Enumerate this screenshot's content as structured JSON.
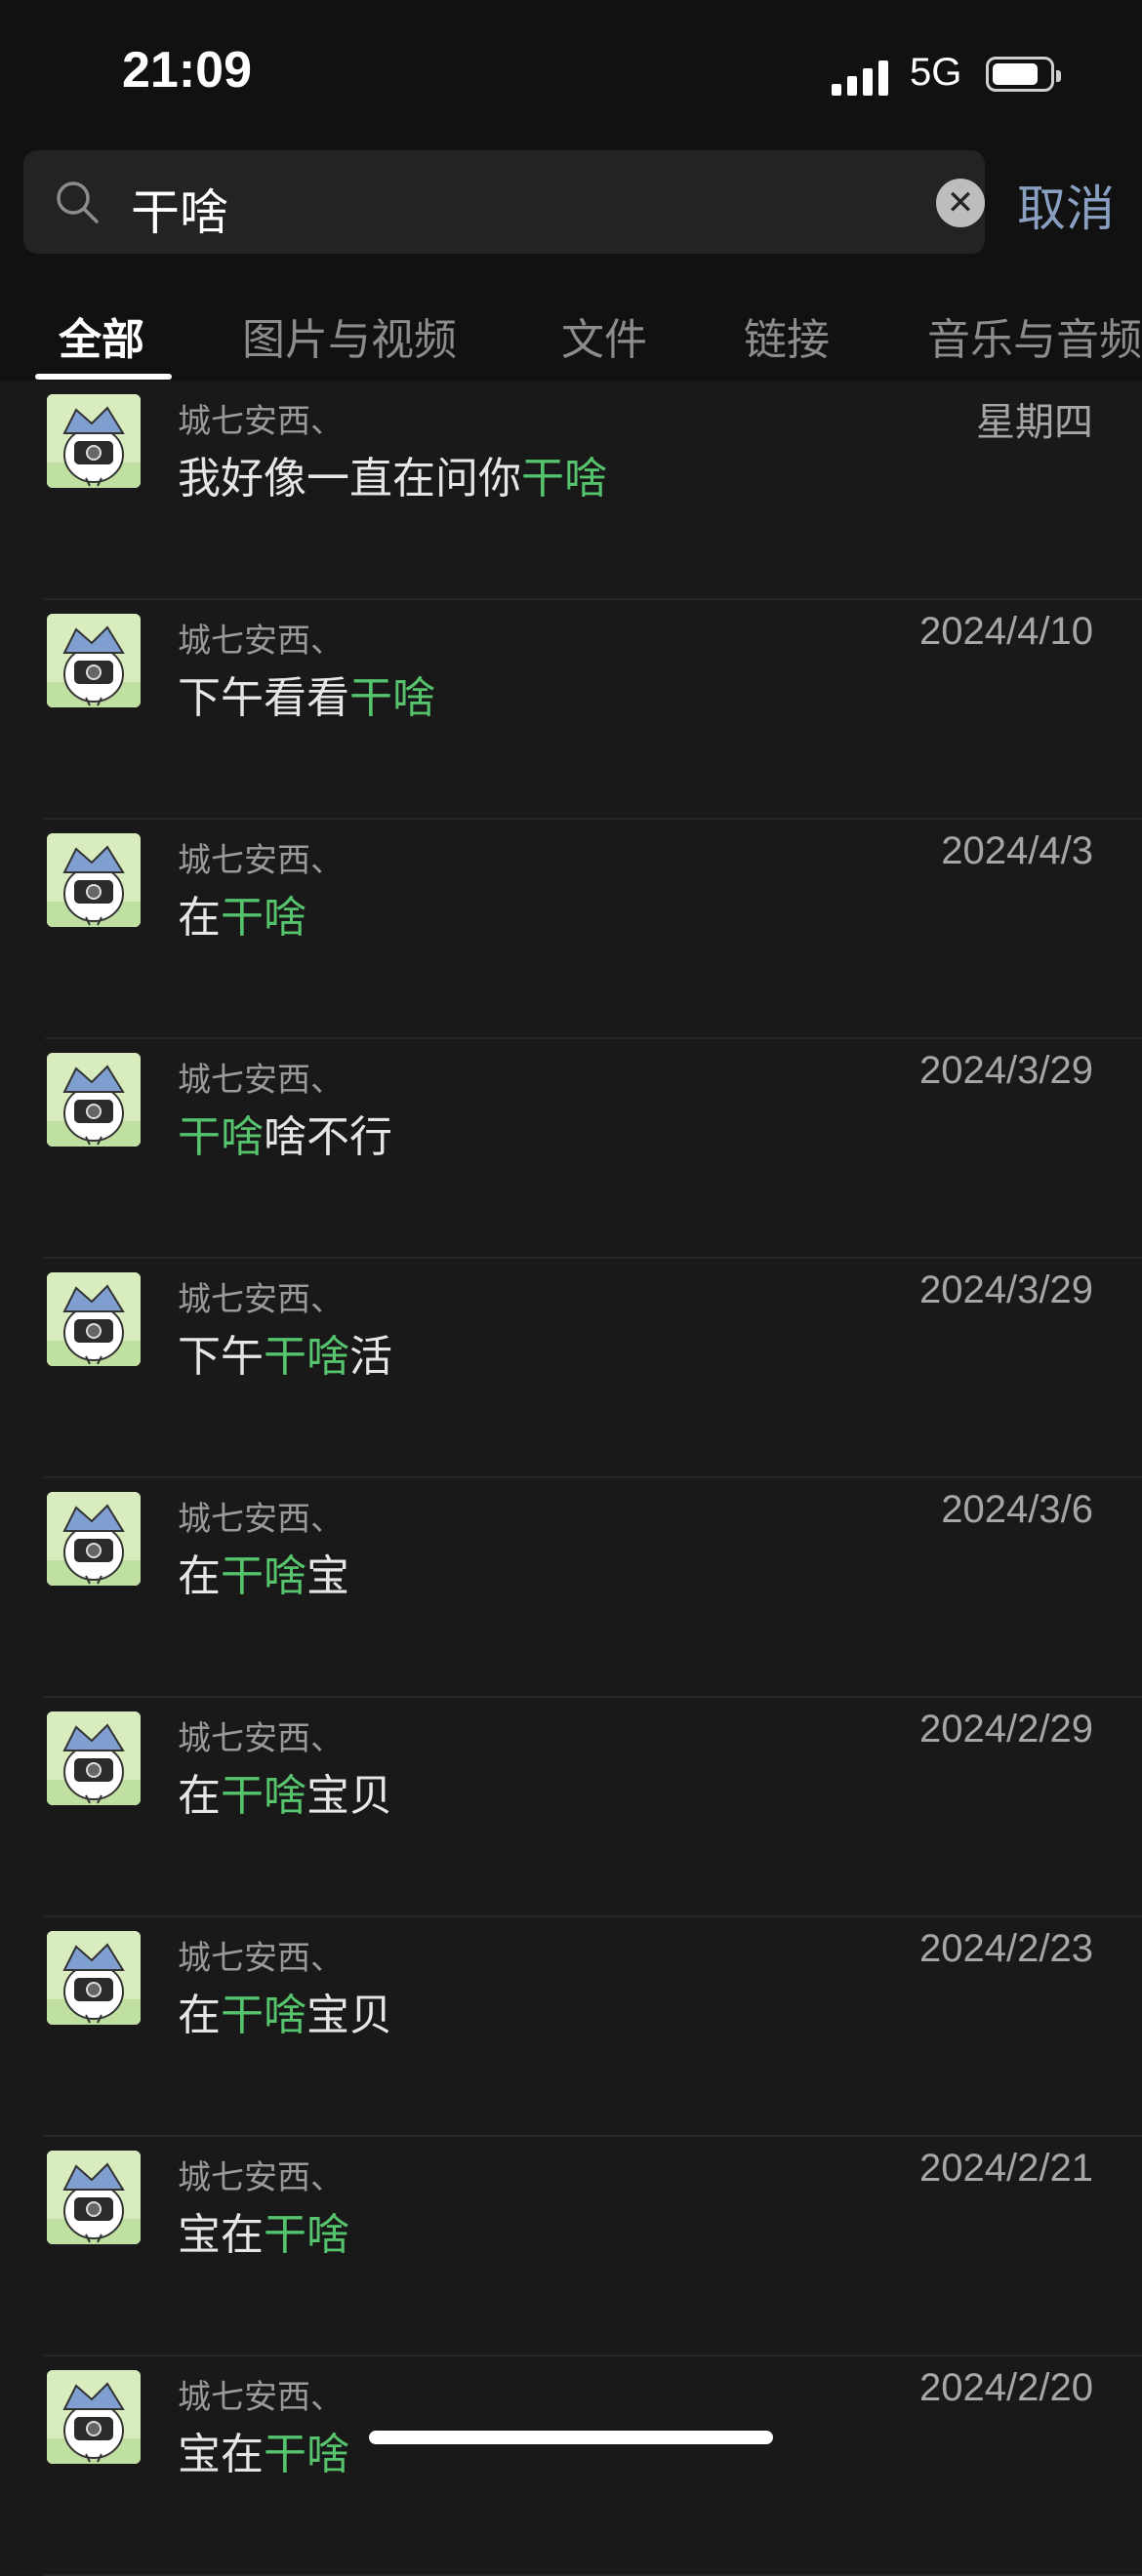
{
  "status": {
    "time": "21:09",
    "network": "5G"
  },
  "search": {
    "query": "干啥",
    "cancel_label": "取消"
  },
  "tabs": [
    {
      "label": "全部",
      "active": true
    },
    {
      "label": "图片与视频",
      "active": false
    },
    {
      "label": "文件",
      "active": false
    },
    {
      "label": "链接",
      "active": false
    },
    {
      "label": "音乐与音频",
      "active": false
    }
  ],
  "highlight_color": "#56c36d",
  "results": [
    {
      "sender": "城七安西、",
      "date": "星期四",
      "message": "我好像一直在问你干啥"
    },
    {
      "sender": "城七安西、",
      "date": "2024/4/10",
      "message": "下午看看干啥"
    },
    {
      "sender": "城七安西、",
      "date": "2024/4/3",
      "message": "在干啥"
    },
    {
      "sender": "城七安西、",
      "date": "2024/3/29",
      "message": "干啥啥不行"
    },
    {
      "sender": "城七安西、",
      "date": "2024/3/29",
      "message": "下午干啥活"
    },
    {
      "sender": "城七安西、",
      "date": "2024/3/6",
      "message": "在干啥宝"
    },
    {
      "sender": "城七安西、",
      "date": "2024/2/29",
      "message": "在干啥宝贝"
    },
    {
      "sender": "城七安西、",
      "date": "2024/2/23",
      "message": "在干啥宝贝"
    },
    {
      "sender": "城七安西、",
      "date": "2024/2/21",
      "message": "宝在干啥"
    },
    {
      "sender": "城七安西、",
      "date": "2024/2/20",
      "message": "宝在干啥"
    }
  ]
}
